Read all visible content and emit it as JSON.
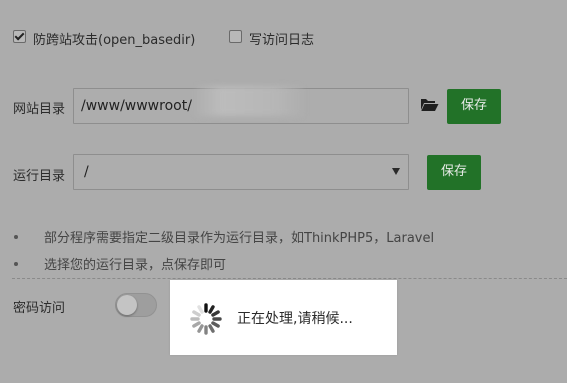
{
  "options": {
    "anti_cross_site": {
      "label": "防跨站攻击(open_basedir)",
      "checked": true
    },
    "access_log": {
      "label": "写访问日志",
      "checked": false
    }
  },
  "site_dir": {
    "label": "网站目录",
    "value": "/www/wwwroot/",
    "folder_icon": "folder-open-icon",
    "save_label": "保存"
  },
  "run_dir": {
    "label": "运行目录",
    "value": "/",
    "save_label": "保存"
  },
  "tips": [
    "部分程序需要指定二级目录作为运行目录，如ThinkPHP5，Laravel",
    "选择您的运行目录，点保存即可"
  ],
  "password_access": {
    "label": "密码访问",
    "enabled": false
  },
  "loading": {
    "text": "正在处理,请稍候...",
    "icon": "spinner-icon"
  },
  "colors": {
    "overlay_background": "#acacac",
    "button_green": "#227228",
    "dialog_background": "#ffffff"
  }
}
